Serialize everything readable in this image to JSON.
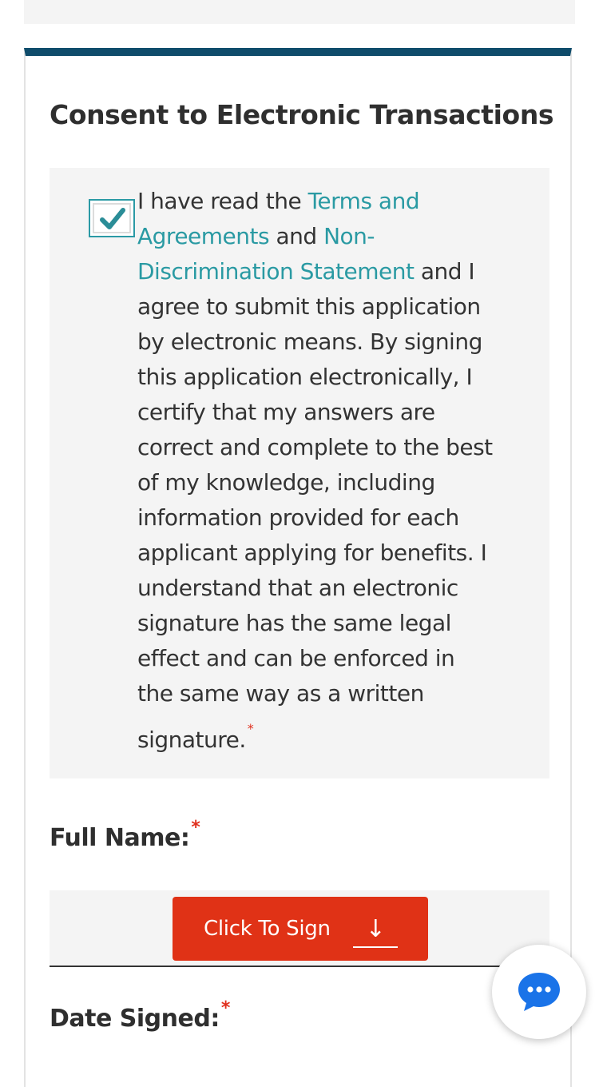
{
  "section": {
    "title": "Consent to Electronic Transactions"
  },
  "consent": {
    "checked": true,
    "text_before": "I have read the ",
    "terms_link": "Terms and Agreements",
    "text_and": " and ",
    "nondiscrimination_link": "Non-Discrimination Statement",
    "text_after": " and I agree to submit this application by electronic means. By signing this application electronically, I certify that my answers are correct and complete to the best of my knowledge, including information provided for each applicant applying for benefits. I understand that an electronic signature has the same legal effect and can be enforced in the same way as a written signature.",
    "required_mark": "*"
  },
  "full_name": {
    "label": "Full Name:",
    "required_mark": "*"
  },
  "sign_button": {
    "label": "Click To Sign",
    "arrow": "↓"
  },
  "date_signed": {
    "label": "Date Signed:",
    "required_mark": "*"
  },
  "colors": {
    "accent_bar": "#0f4c6b",
    "link": "#2a9aa3",
    "sign_button": "#e03216",
    "required": "#e0301e",
    "chat_icon": "#1a73e8"
  },
  "icons": {
    "checkbox": "checkmark-icon",
    "sign_arrow": "arrow-down-icon",
    "chat": "chat-bubble-icon"
  }
}
